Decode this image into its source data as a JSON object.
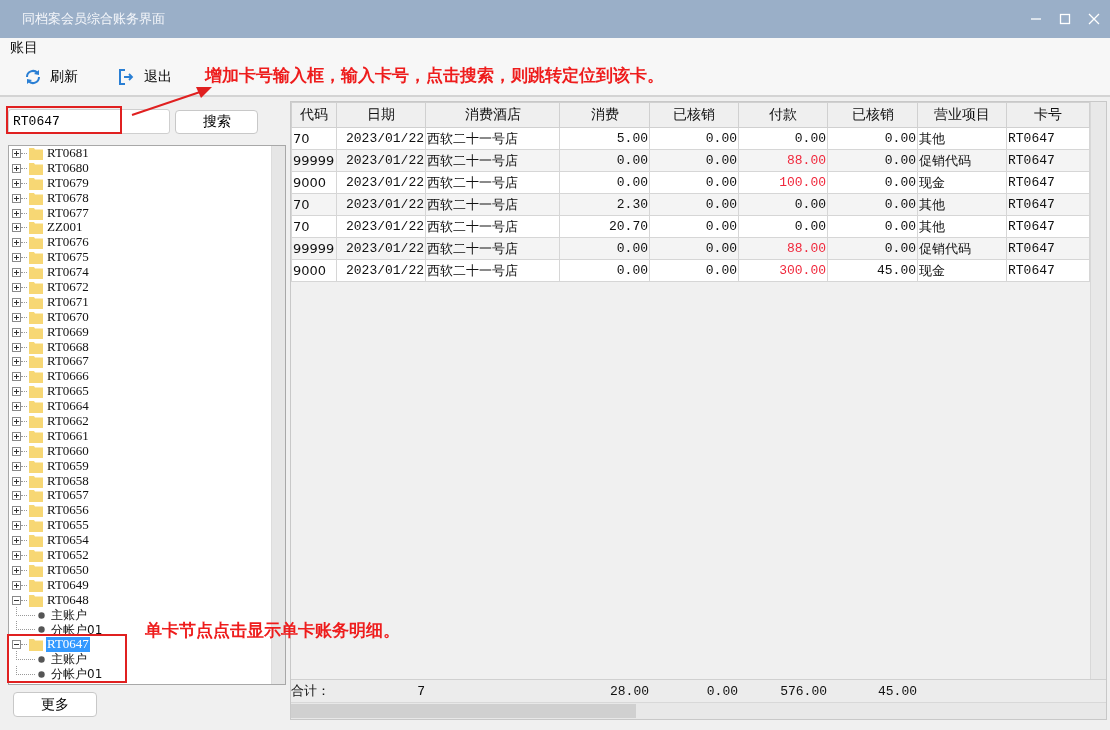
{
  "window": {
    "title": "同档案会员综合账务界面"
  },
  "menu": [
    "账目"
  ],
  "toolbar": [
    {
      "kind": "refresh",
      "label": "刷新"
    },
    {
      "kind": "exit",
      "label": "退出"
    }
  ],
  "search": {
    "value": "RT0647",
    "button": "搜索"
  },
  "tree": [
    {
      "label": "RT0681",
      "expanded": false,
      "selected": false
    },
    {
      "label": "RT0680",
      "expanded": false,
      "selected": false
    },
    {
      "label": "RT0679",
      "expanded": false,
      "selected": false
    },
    {
      "label": "RT0678",
      "expanded": false,
      "selected": false
    },
    {
      "label": "RT0677",
      "expanded": false,
      "selected": false
    },
    {
      "label": "ZZ001",
      "expanded": false,
      "selected": false
    },
    {
      "label": "RT0676",
      "expanded": false,
      "selected": false
    },
    {
      "label": "RT0675",
      "expanded": false,
      "selected": false
    },
    {
      "label": "RT0674",
      "expanded": false,
      "selected": false
    },
    {
      "label": "RT0672",
      "expanded": false,
      "selected": false
    },
    {
      "label": "RT0671",
      "expanded": false,
      "selected": false
    },
    {
      "label": "RT0670",
      "expanded": false,
      "selected": false
    },
    {
      "label": "RT0669",
      "expanded": false,
      "selected": false
    },
    {
      "label": "RT0668",
      "expanded": false,
      "selected": false
    },
    {
      "label": "RT0667",
      "expanded": false,
      "selected": false
    },
    {
      "label": "RT0666",
      "expanded": false,
      "selected": false
    },
    {
      "label": "RT0665",
      "expanded": false,
      "selected": false
    },
    {
      "label": "RT0664",
      "expanded": false,
      "selected": false
    },
    {
      "label": "RT0662",
      "expanded": false,
      "selected": false
    },
    {
      "label": "RT0661",
      "expanded": false,
      "selected": false
    },
    {
      "label": "RT0660",
      "expanded": false,
      "selected": false
    },
    {
      "label": "RT0659",
      "expanded": false,
      "selected": false
    },
    {
      "label": "RT0658",
      "expanded": false,
      "selected": false
    },
    {
      "label": "RT0657",
      "expanded": false,
      "selected": false
    },
    {
      "label": "RT0656",
      "expanded": false,
      "selected": false
    },
    {
      "label": "RT0655",
      "expanded": false,
      "selected": false
    },
    {
      "label": "RT0654",
      "expanded": false,
      "selected": false
    },
    {
      "label": "RT0652",
      "expanded": false,
      "selected": false
    },
    {
      "label": "RT0650",
      "expanded": false,
      "selected": false
    },
    {
      "label": "RT0649",
      "expanded": false,
      "selected": false
    },
    {
      "label": "RT0648",
      "expanded": true,
      "selected": false,
      "children": [
        {
          "label": "主账户"
        },
        {
          "label": "分帐户01"
        }
      ]
    },
    {
      "label": "RT0647",
      "expanded": true,
      "selected": true,
      "children": [
        {
          "label": "主账户"
        },
        {
          "label": "分帐户01"
        }
      ]
    }
  ],
  "more_button": "更多",
  "table": {
    "columns": [
      {
        "label": "代码"
      },
      {
        "label": "日期"
      },
      {
        "label": "消费酒店"
      },
      {
        "label": "消费"
      },
      {
        "label": "已核销"
      },
      {
        "label": "付款"
      },
      {
        "label": "已核销"
      },
      {
        "label": "营业项目"
      },
      {
        "label": "卡号"
      }
    ],
    "rows": [
      {
        "cells": [
          "70",
          "2023/01/22",
          "西软二十一号店",
          "5.00",
          "0.00",
          "0.00",
          "0.00",
          "其他",
          "RT0647"
        ],
        "payment_highlight": false
      },
      {
        "cells": [
          "99999",
          "2023/01/22",
          "西软二十一号店",
          "0.00",
          "0.00",
          "88.00",
          "0.00",
          "促销代码",
          "RT0647"
        ],
        "payment_highlight": true
      },
      {
        "cells": [
          "9000",
          "2023/01/22",
          "西软二十一号店",
          "0.00",
          "0.00",
          "100.00",
          "0.00",
          "现金",
          "RT0647"
        ],
        "payment_highlight": true
      },
      {
        "cells": [
          "70",
          "2023/01/22",
          "西软二十一号店",
          "2.30",
          "0.00",
          "0.00",
          "0.00",
          "其他",
          "RT0647"
        ],
        "payment_highlight": false
      },
      {
        "cells": [
          "70",
          "2023/01/22",
          "西软二十一号店",
          "20.70",
          "0.00",
          "0.00",
          "0.00",
          "其他",
          "RT0647"
        ],
        "payment_highlight": false
      },
      {
        "cells": [
          "99999",
          "2023/01/22",
          "西软二十一号店",
          "0.00",
          "0.00",
          "88.00",
          "0.00",
          "促销代码",
          "RT0647"
        ],
        "payment_highlight": true
      },
      {
        "cells": [
          "9000",
          "2023/01/22",
          "西软二十一号店",
          "0.00",
          "0.00",
          "300.00",
          "45.00",
          "现金",
          "RT0647"
        ],
        "payment_highlight": true
      }
    ]
  },
  "totals": {
    "label": "合计：",
    "count": "7",
    "consumption": "28.00",
    "consumption_written_off": "0.00",
    "payment": "576.00",
    "payment_written_off": "45.00"
  },
  "annotations": [
    {
      "kind": "search",
      "text": "增加卡号输入框，输入卡号，点击搜索，则跳转定位到该卡。"
    },
    {
      "kind": "tree",
      "text": "单卡节点点击显示单卡账务明细。"
    }
  ]
}
